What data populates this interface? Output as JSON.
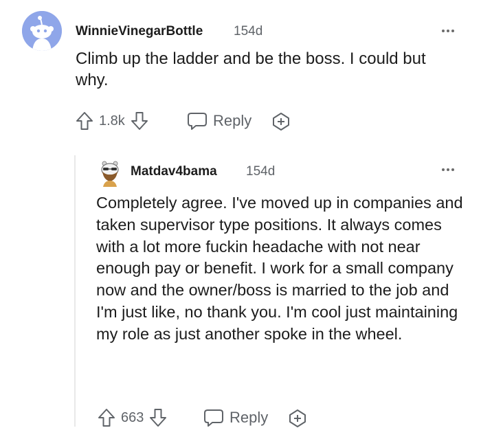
{
  "comment": {
    "username": "WinnieVinegarBottle",
    "age": "154d",
    "text": "Climb up the ladder and be the boss. I could but why.",
    "upvotes": "1.8k",
    "reply_label": "Reply",
    "avatar_color": "#8fa6e9"
  },
  "reply": {
    "username": "Matdav4bama",
    "age": "154d",
    "text": "Completely agree. I've moved up in companies and taken supervisor type positions. It always comes with a lot more fuckin headache with not near enough pay or benefit. I work for a small company now and the owner/boss is married to the job and I'm just like, no thank you. I'm cool just maintaining my role as just another spoke in the wheel.",
    "upvotes": "663",
    "reply_label": "Reply"
  },
  "icons": {
    "upvote": "upvote-arrow-icon",
    "downvote": "downvote-arrow-icon",
    "reply": "speech-bubble-icon",
    "award": "award-plus-icon",
    "more": "more-options-icon"
  },
  "colors": {
    "text": "#1c1c1c",
    "muted": "#5f6368",
    "thread_line": "#e8e8e8"
  }
}
